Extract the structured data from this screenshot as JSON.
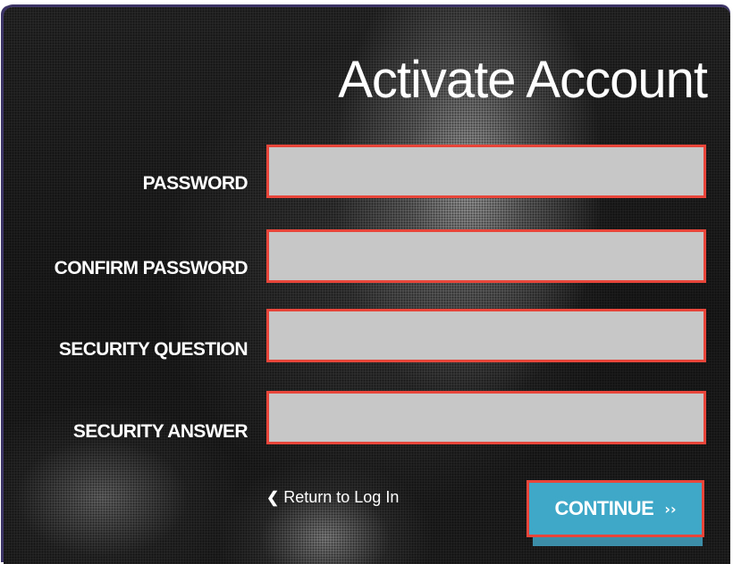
{
  "form": {
    "title": "Activate Account",
    "fields": [
      {
        "label": "PASSWORD",
        "value": "",
        "type": "password"
      },
      {
        "label": "CONFIRM PASSWORD",
        "value": "",
        "type": "password"
      },
      {
        "label": "SECURITY QUESTION",
        "value": "",
        "type": "text"
      },
      {
        "label": "SECURITY ANSWER",
        "value": "",
        "type": "text"
      }
    ],
    "return_link": {
      "label": "Return to Log In",
      "icon": "chevron-left-icon"
    },
    "continue_button": {
      "label": "CONTINUE",
      "icon": "double-chevron-right-icon"
    }
  },
  "colors": {
    "field_border": "#e8453a",
    "field_background": "#c7c7c7",
    "button_background": "#3fa8c8",
    "text": "#ffffff"
  }
}
